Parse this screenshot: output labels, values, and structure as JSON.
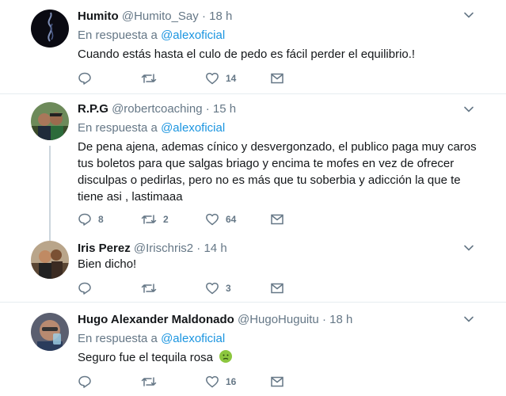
{
  "tweets": [
    {
      "name": "Humito",
      "handle": "@Humito_Say",
      "time": "18 h",
      "reply_prefix": "En respuesta a",
      "reply_to": "@alexoficial",
      "text": "Cuando estás hasta el culo de pedo es fácil perder el equilibrio.!",
      "replies": "",
      "retweets": "",
      "likes": "14"
    },
    {
      "name": "R.P.G",
      "handle": "@robertcoaching",
      "time": "15 h",
      "reply_prefix": "En respuesta a",
      "reply_to": "@alexoficial",
      "text": "De pena ajena, ademas cínico y desvergonzado, el publico paga muy caros tus boletos para que salgas briago y encima te mofes en vez de ofrecer disculpas o pedirlas, pero no es más que tu soberbia y adicción la que te tiene asi , lastimaaa",
      "replies": "8",
      "retweets": "2",
      "likes": "64"
    },
    {
      "name": "Iris Perez",
      "handle": "@Irischris2",
      "time": "14 h",
      "text": "Bien dicho!",
      "replies": "",
      "retweets": "",
      "likes": "3"
    },
    {
      "name": "Hugo Alexander Maldonado",
      "handle": "@HugoHuguitu",
      "time": "18 h",
      "reply_prefix": "En respuesta a",
      "reply_to": "@alexoficial",
      "text": "Seguro fue el tequila rosa",
      "replies": "",
      "retweets": "",
      "likes": "16"
    }
  ],
  "separator": "·",
  "colors": {
    "accent": "#1b95e0",
    "muted": "#657786",
    "text": "#14171a",
    "divider": "#e6ecf0"
  },
  "icons": [
    "reply-icon",
    "retweet-icon",
    "like-icon",
    "message-icon",
    "chevron-down-icon",
    "sick-face-emoji"
  ]
}
